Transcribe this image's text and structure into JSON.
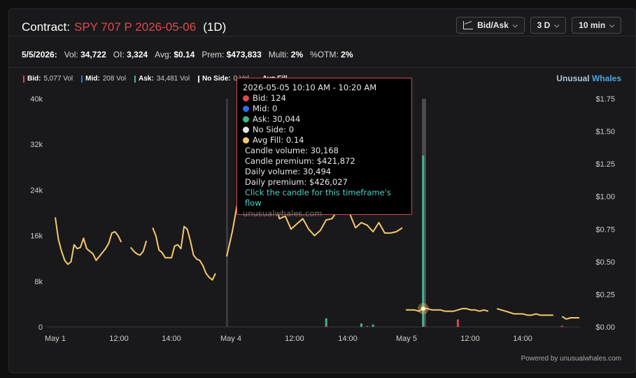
{
  "header": {
    "label": "Contract:",
    "contract": "SPY 707 P 2026-05-06",
    "period": "(1D)"
  },
  "controls": {
    "mode": "Bid/Ask",
    "range": "3 D",
    "interval": "10 min"
  },
  "stats": {
    "date": "5/5/2026:",
    "vol_label": "Vol:",
    "vol": "34,722",
    "oi_label": "OI:",
    "oi": "3,324",
    "avg_label": "Avg:",
    "avg": "$0.14",
    "prem_label": "Prem:",
    "prem": "$473,833",
    "multi_label": "Multi:",
    "multi": "2%",
    "otm_label": "%OTM:",
    "otm": "2%"
  },
  "legend": {
    "bid_label": "Bid:",
    "bid": "5,077 Vol",
    "mid_label": "Mid:",
    "mid": "208 Vol",
    "ask_label": "Ask:",
    "ask": "34,481 Vol",
    "noside_label": "No Side:",
    "noside": "0 Vol",
    "avgfill_label": "Avg Fill"
  },
  "brand": {
    "part1": "Unusual",
    "part2": "Whales"
  },
  "tooltip": {
    "time": "2026-05-05 10:10 AM - 10:20 AM",
    "bid": "Bid: 124",
    "mid": "Mid: 0",
    "ask": "Ask: 30,044",
    "noside": "No Side: 0",
    "avgfill": "Avg Fill: 0.14",
    "candle_volume": "Candle volume: 30,168",
    "candle_premium": "Candle premium: $421,872",
    "daily_volume": "Daily volume: 30,494",
    "daily_premium": "Daily premium: $426,027",
    "link": "Click the candle for this timeframe's flow",
    "watermark": "unusualwhales.com"
  },
  "footer": "Powered by unusualwhales.com",
  "colors": {
    "bid": "#e0474f",
    "mid": "#2f6fe0",
    "ask": "#3fb68b",
    "noside": "#e6e6e6",
    "avgfill": "#f5c96a",
    "brand1": "#a9c7df",
    "brand2": "#4aa8e0"
  },
  "chart_data": {
    "type": "line",
    "title": "",
    "x_ticks": [
      "May 1",
      "12:00",
      "14:00",
      "May 4",
      "12:00",
      "14:00",
      "May 5",
      "12:00",
      "14:00"
    ],
    "y_left_ticks": [
      "0",
      "8k",
      "16k",
      "24k",
      "32k",
      "40k"
    ],
    "y_left_range": [
      0,
      40000
    ],
    "y_right_ticks": [
      "$0.00",
      "$0.25",
      "$0.50",
      "$0.75",
      "$1.00",
      "$1.25",
      "$1.50",
      "$1.75"
    ],
    "y_right_range": [
      0,
      1.75
    ],
    "sessions": [
      {
        "label": "May 1",
        "avg_fill": [
          0.84,
          0.67,
          0.58,
          0.51,
          0.48,
          0.5,
          0.63,
          0.6,
          0.61,
          0.68,
          0.6,
          0.58,
          0.56,
          0.51,
          0.54,
          0.57,
          0.6,
          0.64,
          0.72,
          0.73,
          0.7,
          0.65,
          null,
          null,
          0.61,
          0.58,
          0.56,
          0.55,
          0.58,
          0.66,
          null,
          0.76,
          0.7,
          0.59,
          0.57,
          0.53,
          0.53,
          0.53,
          0.62,
          0.63,
          0.6,
          0.77,
          0.75,
          0.66,
          0.55,
          0.52,
          0.51,
          0.47,
          0.41,
          0.38,
          0.36,
          0.41
        ],
        "bid": [],
        "ask": []
      },
      {
        "label": "May 4",
        "avg_fill": [
          0.54,
          0.74,
          0.99,
          1.12,
          1.06,
          1.03,
          0.98,
          0.94,
          1.0,
          0.83,
          0.85,
          0.75,
          0.79,
          0.83,
          0.75,
          0.7,
          0.74,
          0.82,
          0.83,
          0.9,
          0.9,
          0.87,
          0.76,
          0.8,
          0.78,
          0.73,
          0.8,
          0.72,
          0.72,
          0.73,
          0.76
        ],
        "bid": [
          {
            "i": 17,
            "v": 200
          },
          {
            "i": 24,
            "v": 150
          }
        ],
        "ask": [
          {
            "i": 17,
            "v": 1500
          },
          {
            "i": 23,
            "v": 600
          },
          {
            "i": 25,
            "v": 400
          }
        ]
      },
      {
        "label": "May 5",
        "avg_fill": [
          0.13,
          0.13,
          0.13,
          0.12,
          0.14,
          0.14,
          0.13,
          0.13,
          0.13,
          0.12,
          0.12,
          0.12,
          0.13,
          0.14,
          0.14,
          0.13,
          0.13,
          0.12,
          0.13,
          0.12,
          null,
          0.14,
          0.13,
          0.12,
          0.11,
          0.1,
          0.1,
          0.1,
          0.09,
          0.09,
          0.1,
          0.09,
          0.09,
          0.09,
          0.09,
          null,
          0.08,
          0.06,
          0.07,
          0.07,
          0.07
        ],
        "bid": [
          {
            "i": 4,
            "v": 124
          },
          {
            "i": 12,
            "v": 1300
          },
          {
            "i": 36,
            "v": 200
          }
        ],
        "ask": [
          {
            "i": 4,
            "v": 30044
          }
        ]
      }
    ]
  }
}
